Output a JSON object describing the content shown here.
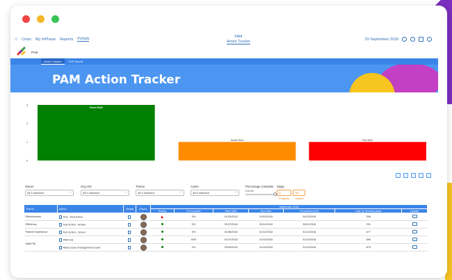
{
  "window": {
    "dots": [
      "#f14444",
      "#f5b829",
      "#36c554"
    ]
  },
  "colors": {
    "accent": "#3a84e8",
    "banner": "#4c96f2",
    "green": "#008000",
    "amber": "#ff8c00",
    "red": "#ff0000"
  },
  "topnav": {
    "links": [
      "Crisis",
      "My InPhase",
      "Reports",
      "Portals"
    ],
    "active": "Portals",
    "center_title": "PAM",
    "center_subtitle": "Action Tracker",
    "date": "29 September 2018"
  },
  "logo": {
    "label": "PAM"
  },
  "tabs": [
    "Action Tracker",
    "PoP Export"
  ],
  "banner": {
    "title": "PAM Action Tracker"
  },
  "chart_data": {
    "type": "bar",
    "categories": [
      "Green RAG",
      "Amber RAG",
      "Red RAG"
    ],
    "values": [
      3,
      1,
      1
    ],
    "colors": [
      "#008000",
      "#ff8c00",
      "#ff0000"
    ],
    "yticks": [
      "0",
      "1",
      "2",
      "3"
    ],
    "ylim": [
      0,
      3
    ],
    "grid": false
  },
  "filters": {
    "owner": {
      "label": "Owner",
      "value": "All 4 selected"
    },
    "orgunit": {
      "label": "Org Unit",
      "value": "All 2 selected"
    },
    "theme": {
      "label": "Theme",
      "value": "All 4 selected"
    },
    "action": {
      "label": "Action",
      "value": "All 5 selected"
    },
    "percentage": {
      "label": "Percentage Complete",
      "value": "0 to 90"
    },
    "stage": {
      "label": "Stage",
      "options": [
        "In Progress",
        "Not Started"
      ]
    }
  },
  "table": {
    "group_header": "September 2018",
    "headers": [
      "Theme",
      "Action",
      "Details",
      "Owner",
      "Rating",
      "% Complete",
      "Start Date",
      "Due Date",
      "Completion (est)",
      "Late by Working Days",
      "Update"
    ],
    "rows": [
      {
        "theme": "Effectiveness",
        "action": "Test - Red Action",
        "rating": "red",
        "complete": "0%",
        "start": "01/03/2018",
        "due": "31/03/2018",
        "est": "31/03/2018",
        "late": "346"
      },
      {
        "theme": "Efficiency",
        "action": "Test Action - Amber",
        "rating": "green",
        "complete": "0%",
        "start": "01/07/2018",
        "due": "30/11/2018",
        "est": "30/11/2018",
        "late": "201"
      },
      {
        "theme": "Patient Experience",
        "action": "Test Action - Green",
        "rating": "green",
        "complete": "0%",
        "start": "01/08/2018",
        "due": "31/12/2018",
        "est": "31/12/2018",
        "late": "477"
      },
      {
        "theme": "",
        "action": "PAM 001",
        "rating": "green",
        "complete": "90%",
        "start": "01/07/2018",
        "due": "31/10/2018",
        "est": "31/10/2018",
        "late": "895"
      },
      {
        "theme": "",
        "action": "Raise issue management board",
        "rating": "green",
        "complete": "0%",
        "start": "29/09/2018",
        "due": "31/10/2018",
        "est": "31/10/2018",
        "late": "875"
      }
    ],
    "merged_theme": "Staff PM"
  }
}
